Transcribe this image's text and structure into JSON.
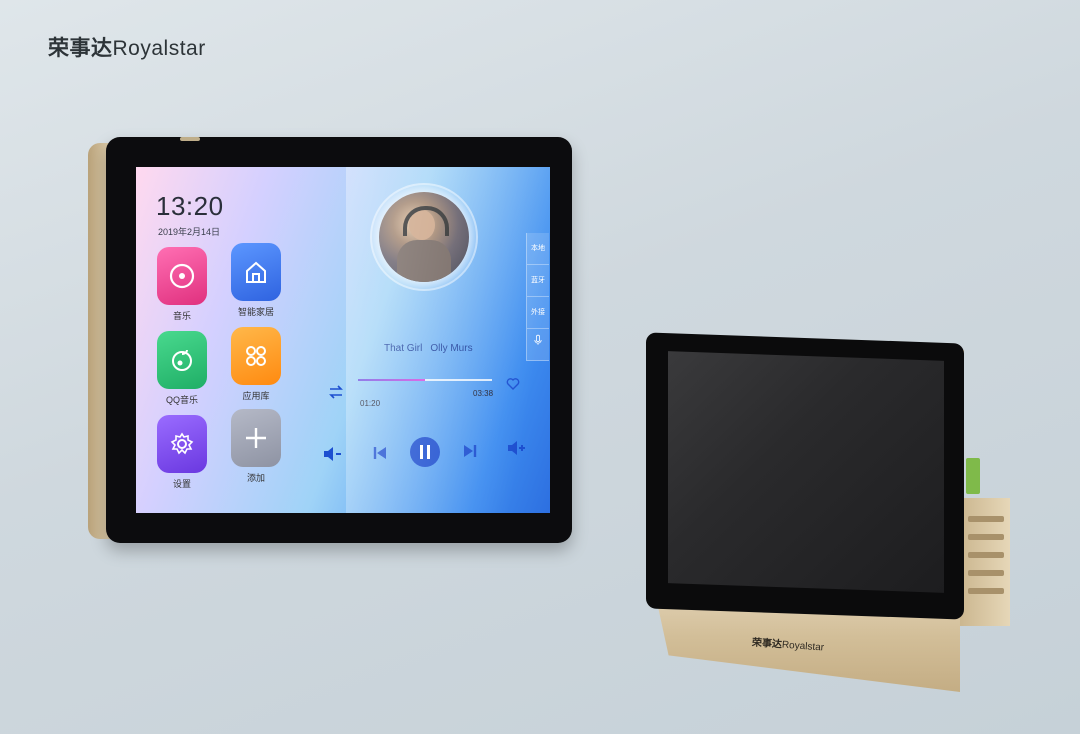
{
  "brand": {
    "name_cn": "荣事达",
    "name_en": "Royalstar"
  },
  "screen": {
    "time": "13:20",
    "date": "2019年2月14日",
    "apps": [
      {
        "label": "音乐",
        "icon": "music-disc-icon",
        "color": "#f0489a"
      },
      {
        "label": "智能家居",
        "icon": "home-icon",
        "color": "#3a76f0"
      },
      {
        "label": "QQ音乐",
        "icon": "qq-music-icon",
        "color": "#2fc27b"
      },
      {
        "label": "应用库",
        "icon": "app-grid-icon",
        "color": "#ff9a1e"
      },
      {
        "label": "设置",
        "icon": "gear-icon",
        "color": "#7b4ef0"
      },
      {
        "label": "添加",
        "icon": "plus-icon",
        "color": "#9aa0b0"
      }
    ],
    "player": {
      "song": "That Girl",
      "artist": "Olly Murs",
      "elapsed": "01:20",
      "total": "03:38",
      "progress": 0.5
    },
    "side_tabs": [
      "本地",
      "蓝牙",
      "外接",
      ""
    ]
  },
  "small_device": {
    "brand_cn": "荣事达",
    "brand_en": "Royalstar"
  }
}
